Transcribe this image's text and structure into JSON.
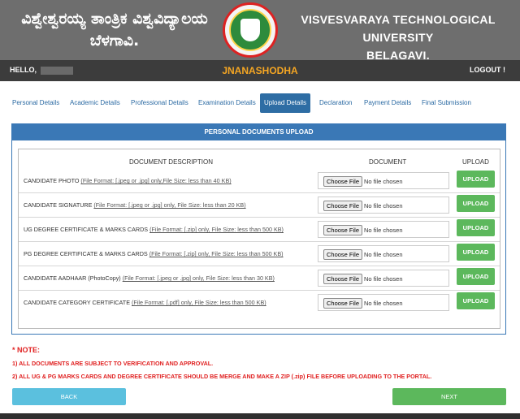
{
  "header": {
    "kn_title_line1": "ವಿಶ್ವೇಶ್ವರಯ್ಯ ತಾಂತ್ರಿಕ ವಿಶ್ವವಿದ್ಯಾಲಯ",
    "kn_title_line2": "ಬೆಳಗಾವಿ.",
    "en_title_line1": "VISVESVARAYA TECHNOLOGICAL UNIVERSITY",
    "en_title_line2": "BELAGAVI."
  },
  "topbar": {
    "hello": "HELLO, ",
    "brand": "JNANASHODHA",
    "logout": "LOGOUT !"
  },
  "tabs": [
    {
      "label": "Personal Details"
    },
    {
      "label": "Academic Details"
    },
    {
      "label": "Professional Details"
    },
    {
      "label": "Examination Details"
    },
    {
      "label": "Upload Details"
    },
    {
      "label": "Declaration"
    },
    {
      "label": "Payment Details"
    },
    {
      "label": "Final Submission"
    }
  ],
  "panel": {
    "title": "PERSONAL DOCUMENTS UPLOAD",
    "col_desc": "DOCUMENT DESCRIPTION",
    "col_doc": "DOCUMENT",
    "col_upload": "UPLOAD",
    "rows": [
      {
        "name": "CANDIDATE PHOTO ",
        "format": "(File Format: [.jpeg or .jpg] only,File Size: less than 40 KB)",
        "choose": "Choose File",
        "status": "No file chosen",
        "upload": "UPLOAD"
      },
      {
        "name": "CANDIDATE SIGNATURE ",
        "format": "(File Format: [.jpeg or .jpg] only, File Size: less than 20 KB)",
        "choose": "Choose File",
        "status": "No file chosen",
        "upload": "UPLOAD"
      },
      {
        "name": "UG DEGREE CERTIFICATE & MARKS CARDS ",
        "format": "(File Format: [.zip] only, File Size: less than 500 KB)",
        "choose": "Choose File",
        "status": "No file chosen",
        "upload": "UPLOAD"
      },
      {
        "name": "PG DEGREE CERTIFICATE & MARKS CARDS ",
        "format": "(File Format: [.zip] only, File Size: less than 500 KB)",
        "choose": "Choose File",
        "status": "No file chosen",
        "upload": "UPLOAD"
      },
      {
        "name": "CANDIDATE AADHAAR (PhotoCopy) ",
        "format": "(File Format: [.jpeg or .jpg] only, File Size: less than 30 KB)",
        "choose": "Choose File",
        "status": "No file chosen",
        "upload": "UPLOAD"
      },
      {
        "name": "CANDIDATE CATEGORY CERTIFICATE ",
        "format": "(File Format: [.pdf] only, File Size: less than 500 KB)",
        "choose": "Choose File",
        "status": "No file chosen",
        "upload": "UPLOAD"
      }
    ]
  },
  "notes": {
    "title": "* NOTE:",
    "line1": "1) ALL DOCUMENTS ARE SUBJECT TO VERIFICATION AND APPROVAL.",
    "line2": "2) ALL UG & PG MARKS CARDS AND DEGREE CERTIFICATE SHOULD BE MERGE AND MAKE A ZIP (.zip) FILE BEFORE UPLOADING TO THE PORTAL."
  },
  "buttons": {
    "back": "BACK",
    "next": "NEXT"
  },
  "colors": {
    "header_bg": "#6e6e6e",
    "topbar_bg": "#3c3c3c",
    "brand": "#f5a623",
    "accent_blue": "#3a78b6",
    "upload_green": "#5cb85c",
    "back_cyan": "#5bc0de",
    "note_red": "#e02020"
  }
}
